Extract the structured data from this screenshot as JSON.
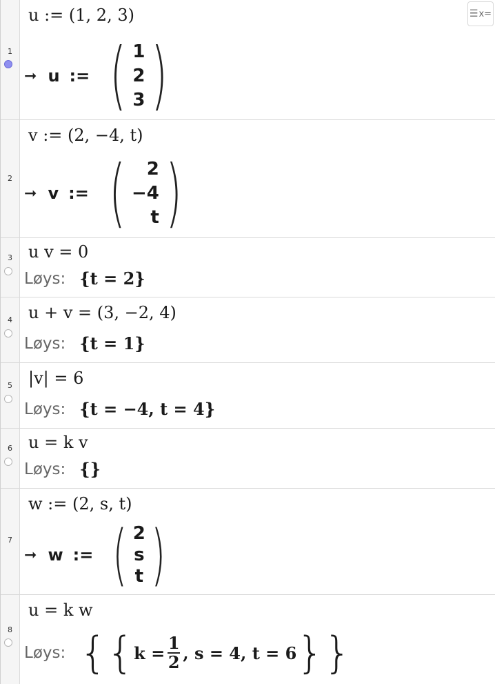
{
  "rows": [
    {
      "num": "1",
      "input": "u := (1, 2, 3)",
      "name": "u",
      "assign": ":=",
      "vector": [
        "1",
        "2",
        "3"
      ]
    },
    {
      "num": "2",
      "input": "v := (2, −4, t)",
      "name": "v",
      "assign": ":=",
      "vector": [
        "2",
        "−4",
        "t"
      ]
    },
    {
      "num": "3",
      "input": "u v  =  0",
      "label": "Løys:",
      "result": "{t = 2}"
    },
    {
      "num": "4",
      "input": "u + v  =  (3, −2, 4)",
      "label": "Løys:",
      "result": "{t = 1}"
    },
    {
      "num": "5",
      "input": "|v|  =  6",
      "label": "Løys:",
      "result": "{t = −4, t = 4}"
    },
    {
      "num": "6",
      "input": "u  =  k v",
      "label": "Løys:",
      "result": "{}"
    },
    {
      "num": "7",
      "input": "w := (2, s, t)",
      "name": "w",
      "assign": ":=",
      "vector": [
        "2",
        "s",
        "t"
      ]
    },
    {
      "num": "8",
      "input": "u  =  k w",
      "label": "Løys:",
      "res_k": "k =",
      "frac_num": "1",
      "frac_den": "2",
      "res_rest": ", s = 4, t = 6"
    }
  ],
  "arrow": "➞",
  "toggle_label": "x="
}
